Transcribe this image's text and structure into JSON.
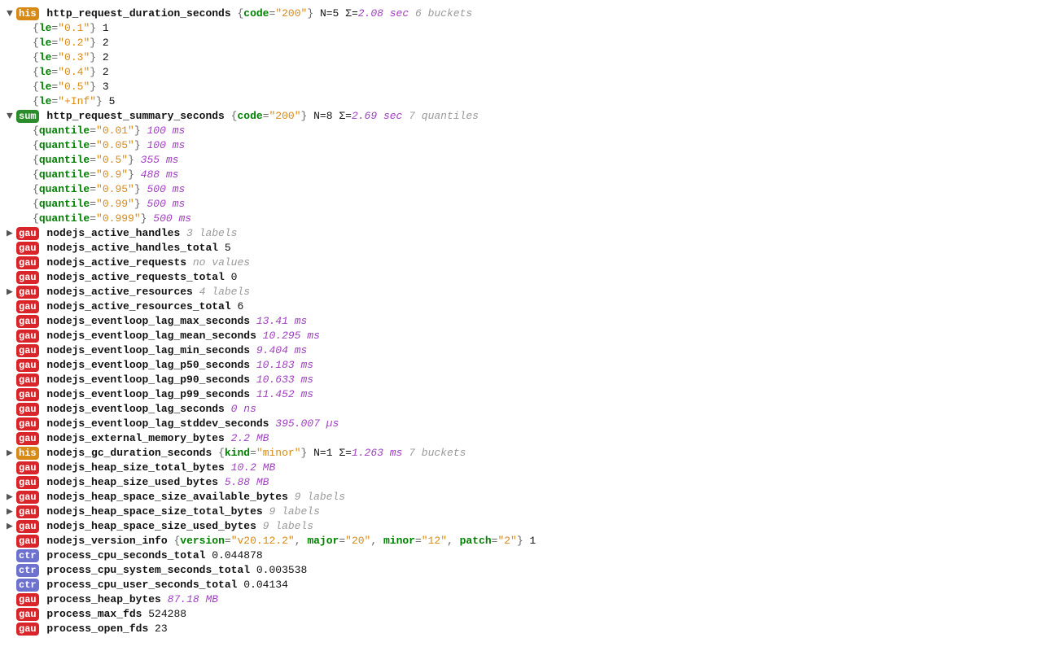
{
  "badges": {
    "gau": "gau",
    "ctr": "ctr",
    "his": "his",
    "sum": "sum"
  },
  "arrows": {
    "open": "▼",
    "closed": "▶"
  },
  "rows": [
    {
      "type": "head",
      "arrow": "open",
      "badge": "his",
      "name": "http_request_duration_seconds",
      "labels": [
        [
          "code",
          "200"
        ]
      ],
      "post": [
        {
          "k": "plain",
          "t": " N=5 Σ="
        },
        {
          "k": "purple",
          "t": "2.08 sec"
        },
        {
          "k": "gray",
          "t": " 6 buckets"
        }
      ]
    },
    {
      "type": "child",
      "labels": [
        [
          "le",
          "0.1"
        ]
      ],
      "after": [
        {
          "k": "plain",
          "t": " 1"
        }
      ]
    },
    {
      "type": "child",
      "labels": [
        [
          "le",
          "0.2"
        ]
      ],
      "after": [
        {
          "k": "plain",
          "t": " 2"
        }
      ]
    },
    {
      "type": "child",
      "labels": [
        [
          "le",
          "0.3"
        ]
      ],
      "after": [
        {
          "k": "plain",
          "t": " 2"
        }
      ]
    },
    {
      "type": "child",
      "labels": [
        [
          "le",
          "0.4"
        ]
      ],
      "after": [
        {
          "k": "plain",
          "t": " 2"
        }
      ]
    },
    {
      "type": "child",
      "labels": [
        [
          "le",
          "0.5"
        ]
      ],
      "after": [
        {
          "k": "plain",
          "t": " 3"
        }
      ]
    },
    {
      "type": "child",
      "labels": [
        [
          "le",
          "+Inf"
        ]
      ],
      "after": [
        {
          "k": "plain",
          "t": " 5"
        }
      ]
    },
    {
      "type": "head",
      "arrow": "open",
      "badge": "sum",
      "name": "http_request_summary_seconds",
      "labels": [
        [
          "code",
          "200"
        ]
      ],
      "post": [
        {
          "k": "plain",
          "t": " N=8 Σ="
        },
        {
          "k": "purple",
          "t": "2.69 sec"
        },
        {
          "k": "gray",
          "t": " 7 quantiles"
        }
      ]
    },
    {
      "type": "child",
      "labels": [
        [
          "quantile",
          "0.01"
        ]
      ],
      "after": [
        {
          "k": "purple",
          "t": " 100 ms"
        }
      ]
    },
    {
      "type": "child",
      "labels": [
        [
          "quantile",
          "0.05"
        ]
      ],
      "after": [
        {
          "k": "purple",
          "t": " 100 ms"
        }
      ]
    },
    {
      "type": "child",
      "labels": [
        [
          "quantile",
          "0.5"
        ]
      ],
      "after": [
        {
          "k": "purple",
          "t": " 355 ms"
        }
      ]
    },
    {
      "type": "child",
      "labels": [
        [
          "quantile",
          "0.9"
        ]
      ],
      "after": [
        {
          "k": "purple",
          "t": " 488 ms"
        }
      ]
    },
    {
      "type": "child",
      "labels": [
        [
          "quantile",
          "0.95"
        ]
      ],
      "after": [
        {
          "k": "purple",
          "t": " 500 ms"
        }
      ]
    },
    {
      "type": "child",
      "labels": [
        [
          "quantile",
          "0.99"
        ]
      ],
      "after": [
        {
          "k": "purple",
          "t": " 500 ms"
        }
      ]
    },
    {
      "type": "child",
      "labels": [
        [
          "quantile",
          "0.999"
        ]
      ],
      "after": [
        {
          "k": "purple",
          "t": " 500 ms"
        }
      ]
    },
    {
      "type": "head",
      "arrow": "closed",
      "badge": "gau",
      "name": "nodejs_active_handles",
      "post": [
        {
          "k": "gray",
          "t": " 3 labels"
        }
      ]
    },
    {
      "type": "head",
      "badge": "gau",
      "name": "nodejs_active_handles_total",
      "post": [
        {
          "k": "plain",
          "t": " 5"
        }
      ]
    },
    {
      "type": "head",
      "badge": "gau",
      "name": "nodejs_active_requests",
      "post": [
        {
          "k": "gray",
          "t": " no values"
        }
      ]
    },
    {
      "type": "head",
      "badge": "gau",
      "name": "nodejs_active_requests_total",
      "post": [
        {
          "k": "plain",
          "t": " 0"
        }
      ]
    },
    {
      "type": "head",
      "arrow": "closed",
      "badge": "gau",
      "name": "nodejs_active_resources",
      "post": [
        {
          "k": "gray",
          "t": " 4 labels"
        }
      ]
    },
    {
      "type": "head",
      "badge": "gau",
      "name": "nodejs_active_resources_total",
      "post": [
        {
          "k": "plain",
          "t": " 6"
        }
      ]
    },
    {
      "type": "head",
      "badge": "gau",
      "name": "nodejs_eventloop_lag_max_seconds",
      "post": [
        {
          "k": "purple",
          "t": " 13.41 ms"
        }
      ]
    },
    {
      "type": "head",
      "badge": "gau",
      "name": "nodejs_eventloop_lag_mean_seconds",
      "post": [
        {
          "k": "purple",
          "t": " 10.295 ms"
        }
      ]
    },
    {
      "type": "head",
      "badge": "gau",
      "name": "nodejs_eventloop_lag_min_seconds",
      "post": [
        {
          "k": "purple",
          "t": " 9.404 ms"
        }
      ]
    },
    {
      "type": "head",
      "badge": "gau",
      "name": "nodejs_eventloop_lag_p50_seconds",
      "post": [
        {
          "k": "purple",
          "t": " 10.183 ms"
        }
      ]
    },
    {
      "type": "head",
      "badge": "gau",
      "name": "nodejs_eventloop_lag_p90_seconds",
      "post": [
        {
          "k": "purple",
          "t": " 10.633 ms"
        }
      ]
    },
    {
      "type": "head",
      "badge": "gau",
      "name": "nodejs_eventloop_lag_p99_seconds",
      "post": [
        {
          "k": "purple",
          "t": " 11.452 ms"
        }
      ]
    },
    {
      "type": "head",
      "badge": "gau",
      "name": "nodejs_eventloop_lag_seconds",
      "post": [
        {
          "k": "purple",
          "t": " 0 ns"
        }
      ]
    },
    {
      "type": "head",
      "badge": "gau",
      "name": "nodejs_eventloop_lag_stddev_seconds",
      "post": [
        {
          "k": "purple",
          "t": " 395.007 µs"
        }
      ]
    },
    {
      "type": "head",
      "badge": "gau",
      "name": "nodejs_external_memory_bytes",
      "post": [
        {
          "k": "purple",
          "t": " 2.2 MB"
        }
      ]
    },
    {
      "type": "head",
      "arrow": "closed",
      "badge": "his",
      "name": "nodejs_gc_duration_seconds",
      "labels": [
        [
          "kind",
          "minor"
        ]
      ],
      "post": [
        {
          "k": "plain",
          "t": " N=1 Σ="
        },
        {
          "k": "purple",
          "t": "1.263 ms"
        },
        {
          "k": "gray",
          "t": " 7 buckets"
        }
      ]
    },
    {
      "type": "head",
      "badge": "gau",
      "name": "nodejs_heap_size_total_bytes",
      "post": [
        {
          "k": "purple",
          "t": " 10.2 MB"
        }
      ]
    },
    {
      "type": "head",
      "badge": "gau",
      "name": "nodejs_heap_size_used_bytes",
      "post": [
        {
          "k": "purple",
          "t": " 5.88 MB"
        }
      ]
    },
    {
      "type": "head",
      "arrow": "closed",
      "badge": "gau",
      "name": "nodejs_heap_space_size_available_bytes",
      "post": [
        {
          "k": "gray",
          "t": " 9 labels"
        }
      ]
    },
    {
      "type": "head",
      "arrow": "closed",
      "badge": "gau",
      "name": "nodejs_heap_space_size_total_bytes",
      "post": [
        {
          "k": "gray",
          "t": " 9 labels"
        }
      ]
    },
    {
      "type": "head",
      "arrow": "closed",
      "badge": "gau",
      "name": "nodejs_heap_space_size_used_bytes",
      "post": [
        {
          "k": "gray",
          "t": " 9 labels"
        }
      ]
    },
    {
      "type": "head",
      "badge": "gau",
      "name": "nodejs_version_info",
      "labels": [
        [
          "version",
          "v20.12.2"
        ],
        [
          "major",
          "20"
        ],
        [
          "minor",
          "12"
        ],
        [
          "patch",
          "2"
        ]
      ],
      "post": [
        {
          "k": "plain",
          "t": " 1"
        }
      ]
    },
    {
      "type": "head",
      "badge": "ctr",
      "name": "process_cpu_seconds_total",
      "post": [
        {
          "k": "plain",
          "t": " 0.044878"
        }
      ]
    },
    {
      "type": "head",
      "badge": "ctr",
      "name": "process_cpu_system_seconds_total",
      "post": [
        {
          "k": "plain",
          "t": " 0.003538"
        }
      ]
    },
    {
      "type": "head",
      "badge": "ctr",
      "name": "process_cpu_user_seconds_total",
      "post": [
        {
          "k": "plain",
          "t": " 0.04134"
        }
      ]
    },
    {
      "type": "head",
      "badge": "gau",
      "name": "process_heap_bytes",
      "post": [
        {
          "k": "purple",
          "t": " 87.18 MB"
        }
      ]
    },
    {
      "type": "head",
      "badge": "gau",
      "name": "process_max_fds",
      "post": [
        {
          "k": "plain",
          "t": " 524288"
        }
      ]
    },
    {
      "type": "head",
      "badge": "gau",
      "name": "process_open_fds",
      "post": [
        {
          "k": "plain",
          "t": " 23"
        }
      ]
    }
  ]
}
